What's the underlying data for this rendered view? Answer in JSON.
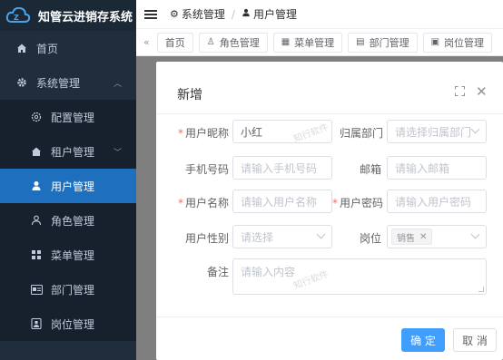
{
  "app": {
    "title": "知管云进销存系统"
  },
  "sidebar": {
    "items": [
      {
        "label": "首页",
        "icon": "home-icon"
      },
      {
        "label": "系统管理",
        "icon": "gear-icon"
      },
      {
        "label": "配置管理",
        "icon": "settings-icon"
      },
      {
        "label": "租户管理",
        "icon": "house-icon"
      },
      {
        "label": "用户管理",
        "icon": "user-icon"
      },
      {
        "label": "角色管理",
        "icon": "person-outline-icon"
      },
      {
        "label": "菜单管理",
        "icon": "grid-icon"
      },
      {
        "label": "部门管理",
        "icon": "id-card-icon"
      },
      {
        "label": "岗位管理",
        "icon": "badge-icon"
      }
    ]
  },
  "header": {
    "breadcrumb": [
      "系统管理",
      "用户管理"
    ]
  },
  "tags": [
    "首页",
    "角色管理",
    "菜单管理",
    "部门管理",
    "岗位管理"
  ],
  "dialog": {
    "title": "新增",
    "watermark": "知行软件",
    "fields": {
      "nickname": {
        "label": "用户昵称",
        "value": "小红"
      },
      "dept": {
        "label": "归属部门",
        "placeholder": "请选择归属部门"
      },
      "phone": {
        "label": "手机号码",
        "placeholder": "请输入手机号码"
      },
      "email": {
        "label": "邮箱",
        "placeholder": "请输入邮箱"
      },
      "username": {
        "label": "用户名称",
        "placeholder": "请输入用户名称"
      },
      "password": {
        "label": "用户密码",
        "placeholder": "请输入用户密码"
      },
      "gender": {
        "label": "用户性别",
        "placeholder": "请选择"
      },
      "post": {
        "label": "岗位",
        "chip": "销售"
      },
      "remark": {
        "label": "备注",
        "placeholder": "请输入内容"
      }
    },
    "confirm": "确 定",
    "cancel": "取 消"
  },
  "colors": {
    "sidebar": "#1f2d3d",
    "active": "#1e6fbe",
    "primary": "#409eff",
    "required": "#f56c6c"
  }
}
